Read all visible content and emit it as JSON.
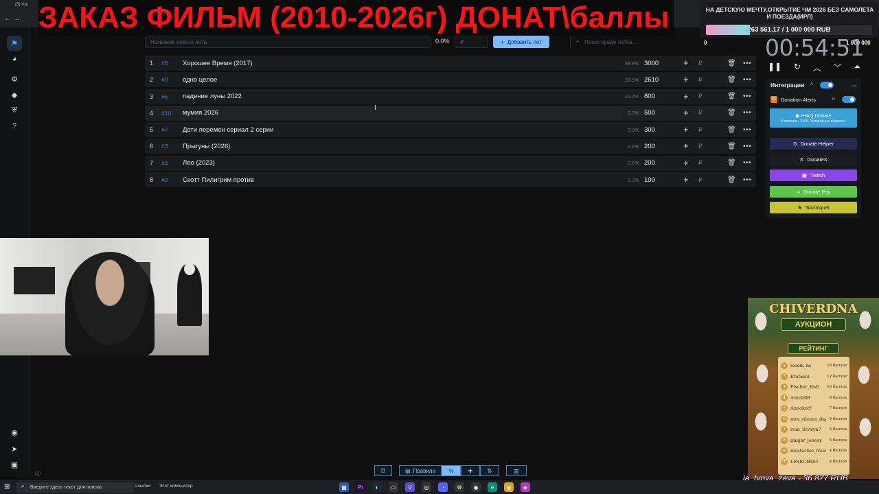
{
  "browser": {
    "tab_label": "(3) You"
  },
  "banner": {
    "text": "ЗАКАЗ ФИЛЬМ (2010-2026г) ДОНАТ\\баллы"
  },
  "lot_form": {
    "name_placeholder": "Название нового лота",
    "percent": "0.0%",
    "amount_placeholder": "₽",
    "add_label": "Добавить лот",
    "search_placeholder": "Поиск среди лотов..."
  },
  "lots": [
    {
      "num": "1",
      "id": "#6",
      "name": "Хорошее Время (2017)",
      "pct": "38.9%",
      "amount": "3000"
    },
    {
      "num": "2",
      "id": "#9",
      "name": "одно целое",
      "pct": "33.9%",
      "amount": "2610"
    },
    {
      "num": "3",
      "id": "#5",
      "name": "падение луны 2022",
      "pct": "10.4%",
      "amount": "800"
    },
    {
      "num": "4",
      "id": "#10",
      "name": "мумия 2026",
      "pct": "6.5%",
      "amount": "500"
    },
    {
      "num": "5",
      "id": "#7",
      "name": "Дети перемен сериал 2 серии",
      "pct": "3.9%",
      "amount": "300"
    },
    {
      "num": "6",
      "id": "#3",
      "name": "Прыгуны (2026)",
      "pct": "2.6%",
      "amount": "200"
    },
    {
      "num": "7",
      "id": "#4",
      "name": "Лео (2023)",
      "pct": "2.6%",
      "amount": "200"
    },
    {
      "num": "8",
      "id": "#2",
      "name": "Скотт Пилигрим против",
      "pct": "1.3%",
      "amount": "100"
    }
  ],
  "lot_currency": "₽",
  "goal": {
    "title": "НА ДЕТСКУЮ МЕЧТУ,ОТКРЫТИЕ ЧМ 2026 БЕЗ САМОЛЕТА И ПОЕЗДА(ИРЛ)",
    "progress_text": "263 561.17 / 1 000 000 RUB",
    "progress_fraction": 0.2636,
    "min": "0",
    "max": "1 000 000"
  },
  "timer": {
    "value": "00:54:51"
  },
  "integrations": {
    "title": "Интеграции",
    "a_mark": "A",
    "da_label": "Donation Alerts",
    "da_mark": "D",
    "services": [
      {
        "label": "IHAQ Donate",
        "sub": "Комиссия – 3,5%. Уникальные виджеты!",
        "color": "#3aa0d8"
      },
      {
        "label": "Donate Helper",
        "color": "#272b52"
      },
      {
        "label": "DonateX",
        "color": "#1c1d20"
      },
      {
        "label": "Twitch",
        "color": "#8a45e8"
      },
      {
        "label": "Donate Pay",
        "color": "#5bc64a"
      },
      {
        "label": "Tourniquet",
        "color": "#c7c236"
      }
    ]
  },
  "poster": {
    "title": "CHIVERDNA",
    "subtitle": "АУКЦИОН",
    "rating_label": "РЕЙТИНГ",
    "rows": [
      {
        "rank": "1",
        "name": "lesnik_bs",
        "points": "18 баллов"
      },
      {
        "rank": "2",
        "name": "Ktotakoi",
        "points": "12 баллов"
      },
      {
        "rank": "3",
        "name": "Fischer_RnD",
        "points": "10 баллов"
      },
      {
        "rank": "4",
        "name": "ArnoldM",
        "points": "9 баллов"
      },
      {
        "rank": "5",
        "name": "Annakorf",
        "points": "7 баллов"
      },
      {
        "rank": "6",
        "name": "mrs_silence_dagoed",
        "points": "5 баллов"
      },
      {
        "rank": "7",
        "name": "ivan_ilcitsyn7",
        "points": "5 баллов"
      },
      {
        "rank": "8",
        "name": "ginger_jonesy",
        "points": "5 баллов"
      },
      {
        "rank": "9",
        "name": "mustachio_fresno_sims",
        "points": "4 баллов"
      },
      {
        "rank": "10",
        "name": "LESECHNO",
        "points": "4 баллов"
      }
    ],
    "footer": "ia_tvoya_zaya - 36 877 RUB"
  },
  "bottom_toolbar": {
    "rules_label": "Правила",
    "percent_symbol": "%"
  },
  "taskbar": {
    "search_placeholder": "Введите здесь текст для поиска",
    "links_label": "Ссылки",
    "pc_label": "Этот компьютер"
  }
}
